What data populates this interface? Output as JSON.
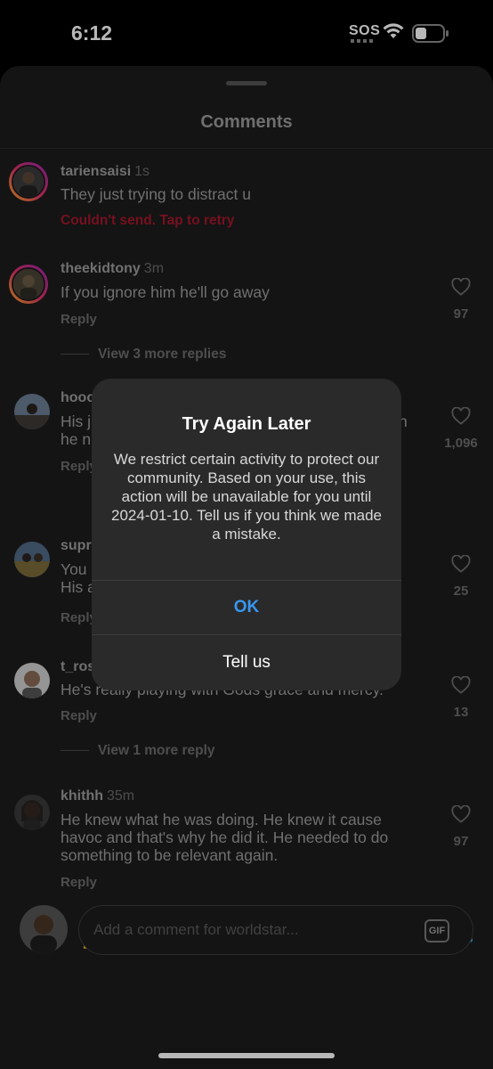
{
  "status_bar": {
    "time": "6:12",
    "sos": "SOS",
    "icons": [
      "wifi-icon",
      "battery-icon"
    ]
  },
  "sheet": {
    "title": "Comments"
  },
  "comments": [
    {
      "username": "tariensaisi",
      "time": "1s",
      "text": "They just trying to distract u",
      "error": "Couldn't send. Tap to retry"
    },
    {
      "username": "theekidtony",
      "time": "3m",
      "text": "If you ignore him he'll go away",
      "reply": "Reply",
      "likes": "97",
      "view_more": "View 3 more replies"
    },
    {
      "username": "hooc",
      "line1": "His j",
      "line1_tail": "n",
      "line2": "he n",
      "reply": "Reply",
      "likes": "1,096"
    },
    {
      "username": "supr",
      "line1": "You",
      "line2": "His a",
      "reply": "Reply",
      "likes": "25"
    },
    {
      "username": "t_ros",
      "text": "He's really playing with Gods grace and mercy.",
      "reply": "Reply",
      "likes": "13",
      "view_more": "View 1 more reply"
    },
    {
      "username": "khithh",
      "time": "35m",
      "text": "He knew what he was doing. He knew it cause havoc and that's why he did it. He needed to do something to be relevant again.",
      "reply": "Reply",
      "likes": "97"
    }
  ],
  "reactions": [
    "❤️",
    "🙌",
    "🔥",
    "👏",
    "😢",
    "😍",
    "😮",
    "😂"
  ],
  "composer": {
    "placeholder": "Add a comment for worldstar...",
    "gif_label": "GIF"
  },
  "alert": {
    "title": "Try Again Later",
    "message": "We restrict certain activity to protect our community. Based on your use, this action will be unavailable for you until 2024-01-10. Tell us if you think we made a mistake.",
    "ok_label": "OK",
    "tell_us_label": "Tell us"
  },
  "colors": {
    "sheet_bg": "#1c1c1c",
    "error_red": "#a4172b",
    "link_blue": "#3897f0",
    "alert_bg": "#2a2a2a"
  }
}
